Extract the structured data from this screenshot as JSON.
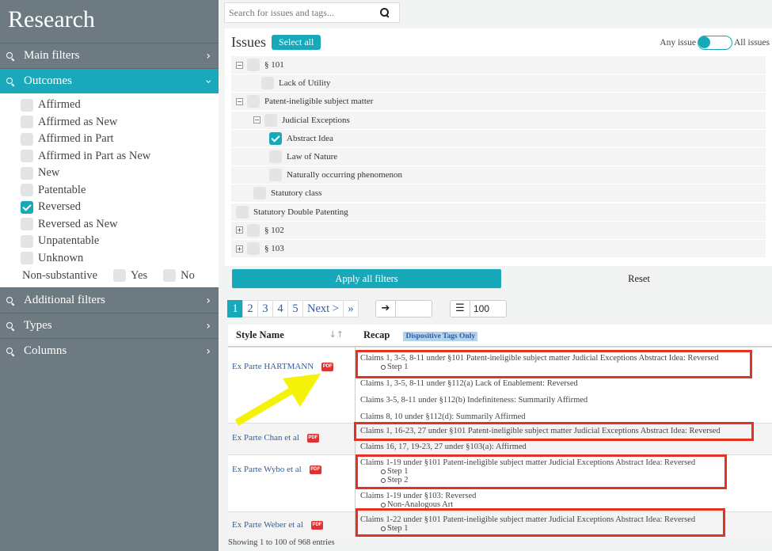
{
  "sidebar": {
    "title": "Research",
    "sections": [
      {
        "label": "Main filters"
      },
      {
        "label": "Outcomes"
      },
      {
        "label": "Additional filters"
      },
      {
        "label": "Types"
      },
      {
        "label": "Columns"
      }
    ],
    "outcomes": [
      {
        "label": "Affirmed",
        "checked": false
      },
      {
        "label": "Affirmed as New",
        "checked": false
      },
      {
        "label": "Affirmed in Part",
        "checked": false
      },
      {
        "label": "Affirmed in Part as New",
        "checked": false
      },
      {
        "label": "New",
        "checked": false
      },
      {
        "label": "Patentable",
        "checked": false
      },
      {
        "label": "Reversed",
        "checked": true
      },
      {
        "label": "Reversed as New",
        "checked": false
      },
      {
        "label": "Unpatentable",
        "checked": false
      },
      {
        "label": "Unknown",
        "checked": false
      }
    ],
    "non_substantive": {
      "label": "Non-substantive",
      "yes": "Yes",
      "no": "No"
    }
  },
  "search": {
    "placeholder": "Search for issues and tags..."
  },
  "issues": {
    "title": "Issues",
    "select_all": "Select all",
    "toggle_left": "Any issue",
    "toggle_right": "All issues",
    "tree": [
      {
        "label": "§ 101",
        "expander": "-",
        "checked": false
      },
      {
        "label": "Lack of Utility",
        "expander": "",
        "checked": false
      },
      {
        "label": "Patent-ineligible subject matter",
        "expander": "-",
        "checked": false
      },
      {
        "label": "Judicial Exceptions",
        "expander": "-",
        "checked": false
      },
      {
        "label": "Abstract Idea",
        "expander": "",
        "checked": true
      },
      {
        "label": "Law of Nature",
        "expander": "",
        "checked": false
      },
      {
        "label": "Naturally occurring phenomenon",
        "expander": "",
        "checked": false
      },
      {
        "label": "Statutory class",
        "expander": "",
        "checked": false
      },
      {
        "label": "Statutory Double Patenting",
        "expander": "",
        "checked": false
      },
      {
        "label": "§ 102",
        "expander": "+",
        "checked": false
      },
      {
        "label": "§ 103",
        "expander": "+",
        "checked": false
      }
    ],
    "apply": "Apply all filters",
    "reset": "Reset"
  },
  "pagination": {
    "pages": [
      "1",
      "2",
      "3",
      "4",
      "5"
    ],
    "next": "Next >",
    "last": "»",
    "goto_icon": "right-arrow-icon",
    "per_page": "100"
  },
  "table": {
    "col_name": "Style Name",
    "col_recap": "Recap",
    "dispositive_tag": "Dispositive Tags Only",
    "rows": [
      {
        "name": "Ex Parte HARTMANN",
        "recaps": [
          {
            "text": "Claims 1, 3-5, 8-11 under §101 Patent-ineligible subject matter Judicial Exceptions Abstract Idea: Reversed",
            "subs": [
              "Step 1"
            ]
          },
          {
            "text": "Claims 1, 3-5, 8-11 under §112(a) Lack of Enablement: Reversed",
            "subs": []
          },
          {
            "text": "Claims 3-5, 8-11 under §112(b) Indefiniteness: Summarily Affirmed",
            "subs": []
          },
          {
            "text": "Claims 8, 10 under §112(d): Summarily Affirmed",
            "subs": []
          }
        ]
      },
      {
        "name": "Ex Parte Chan et al",
        "recaps": [
          {
            "text": "Claims 1, 16-23, 27 under §101 Patent-ineligible subject matter Judicial Exceptions Abstract Idea: Reversed",
            "subs": []
          },
          {
            "text": "Claims 16, 17, 19-23, 27 under §103(a): Affirmed",
            "subs": []
          }
        ]
      },
      {
        "name": "Ex Parte Wybo et al",
        "recaps": [
          {
            "text": "Claims 1-19 under §101 Patent-ineligible subject matter Judicial Exceptions Abstract Idea: Reversed",
            "subs": [
              "Step 1",
              "Step 2"
            ]
          },
          {
            "text": "Claims 1-19 under §103: Reversed",
            "subs": [
              "Non-Analogous Art"
            ]
          }
        ]
      },
      {
        "name": "Ex Parte Weber et al",
        "recaps": [
          {
            "text": "Claims 1-22 under §101 Patent-ineligible subject matter Judicial Exceptions Abstract Idea: Reversed",
            "subs": [
              "Step 1"
            ]
          }
        ]
      }
    ],
    "pdf_label": "PDF",
    "footer": "Showing 1 to 100 of 968 entries"
  },
  "colors": {
    "accent": "#17a9ba",
    "highlight": "#e53120",
    "arrow": "#f5f20a",
    "sidebar": "#6d7a82"
  }
}
